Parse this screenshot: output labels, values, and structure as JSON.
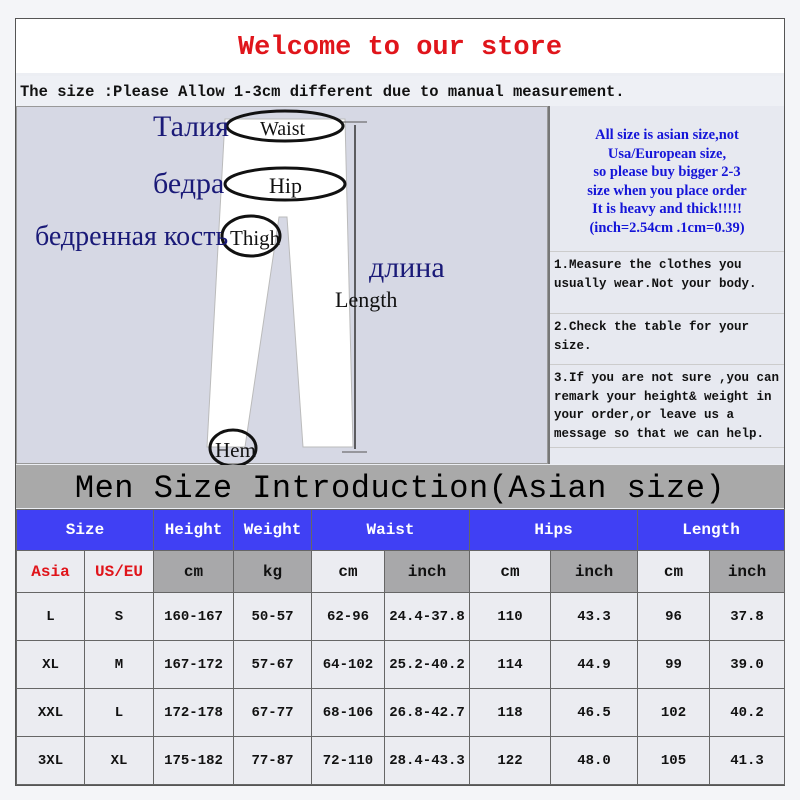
{
  "title": "Welcome to our store",
  "note": "The size :Please Allow 1-3cm different due to manual measurement.",
  "diagram": {
    "waist_ru": "Талия",
    "waist": "Waist",
    "hip_ru": "бедра",
    "hip": "Hip",
    "thigh_ru": "бедренная кость",
    "thigh": "Thigh",
    "length_ru": "длина",
    "length": "Length",
    "hem": "Hem"
  },
  "notice": [
    "All size is asian size,not",
    "Usa/European size,",
    "so please buy bigger 2-3",
    "size when you place order",
    "It is heavy and thick!!!!!",
    "(inch=2.54cm .1cm=0.39)"
  ],
  "notice_color": "#1515d8",
  "steps": [
    "1.Measure the clothes you usually wear.Not your body.",
    "2.Check the table for your size.",
    "3.If you are not sure ,you can remark your height& weight in your order,or leave us a message so that we can help."
  ],
  "band": "Men Size Introduction(Asian size)",
  "table": {
    "headers": [
      "Size",
      "Height",
      "Weight",
      "Waist",
      "Hips",
      "Length"
    ],
    "units": [
      "Asia",
      "US/EU",
      "cm",
      "kg",
      "cm",
      "inch",
      "cm",
      "inch",
      "cm",
      "inch"
    ],
    "rows": [
      [
        "L",
        "S",
        "160-167",
        "50-57",
        "62-96",
        "24.4-37.8",
        "110",
        "43.3",
        "96",
        "37.8"
      ],
      [
        "XL",
        "M",
        "167-172",
        "57-67",
        "64-102",
        "25.2-40.2",
        "114",
        "44.9",
        "99",
        "39.0"
      ],
      [
        "XXL",
        "L",
        "172-178",
        "67-77",
        "68-106",
        "26.8-42.7",
        "118",
        "46.5",
        "102",
        "40.2"
      ],
      [
        "3XL",
        "XL",
        "175-182",
        "77-87",
        "72-110",
        "28.4-43.3",
        "122",
        "48.0",
        "105",
        "41.3"
      ]
    ]
  },
  "colors": {
    "header": "#4040f4",
    "accent": "#e0151b"
  }
}
